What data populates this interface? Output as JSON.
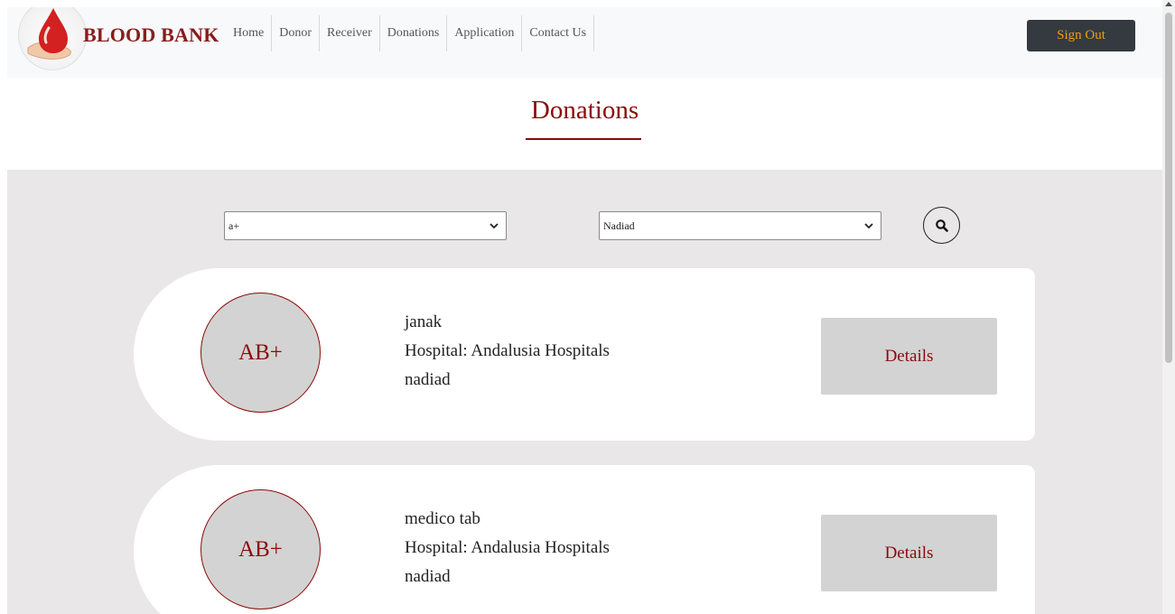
{
  "navbar": {
    "brand": "BLOOD BANK",
    "items": [
      {
        "label": "Home"
      },
      {
        "label": "Donor"
      },
      {
        "label": "Receiver"
      },
      {
        "label": "Donations"
      },
      {
        "label": "Application"
      },
      {
        "label": "Contact Us"
      }
    ],
    "signout_label": "Sign Out"
  },
  "page": {
    "title": "Donations"
  },
  "filters": {
    "blood_group_value": "a+",
    "city_value": "Nadiad",
    "search_icon": "search-icon"
  },
  "donations": [
    {
      "blood_group": "AB+",
      "name": "janak",
      "hospital": "Hospital: Andalusia Hospitals",
      "city": "nadiad",
      "details_label": "Details"
    },
    {
      "blood_group": "AB+",
      "name": "medico tab",
      "hospital": "Hospital: Andalusia Hospitals",
      "city": "nadiad",
      "details_label": "Details"
    }
  ],
  "colors": {
    "brand": "#8a1c1c",
    "accent": "#8b0a0a",
    "signout_text": "#f39c12",
    "section_bg": "#e9e7e7"
  }
}
